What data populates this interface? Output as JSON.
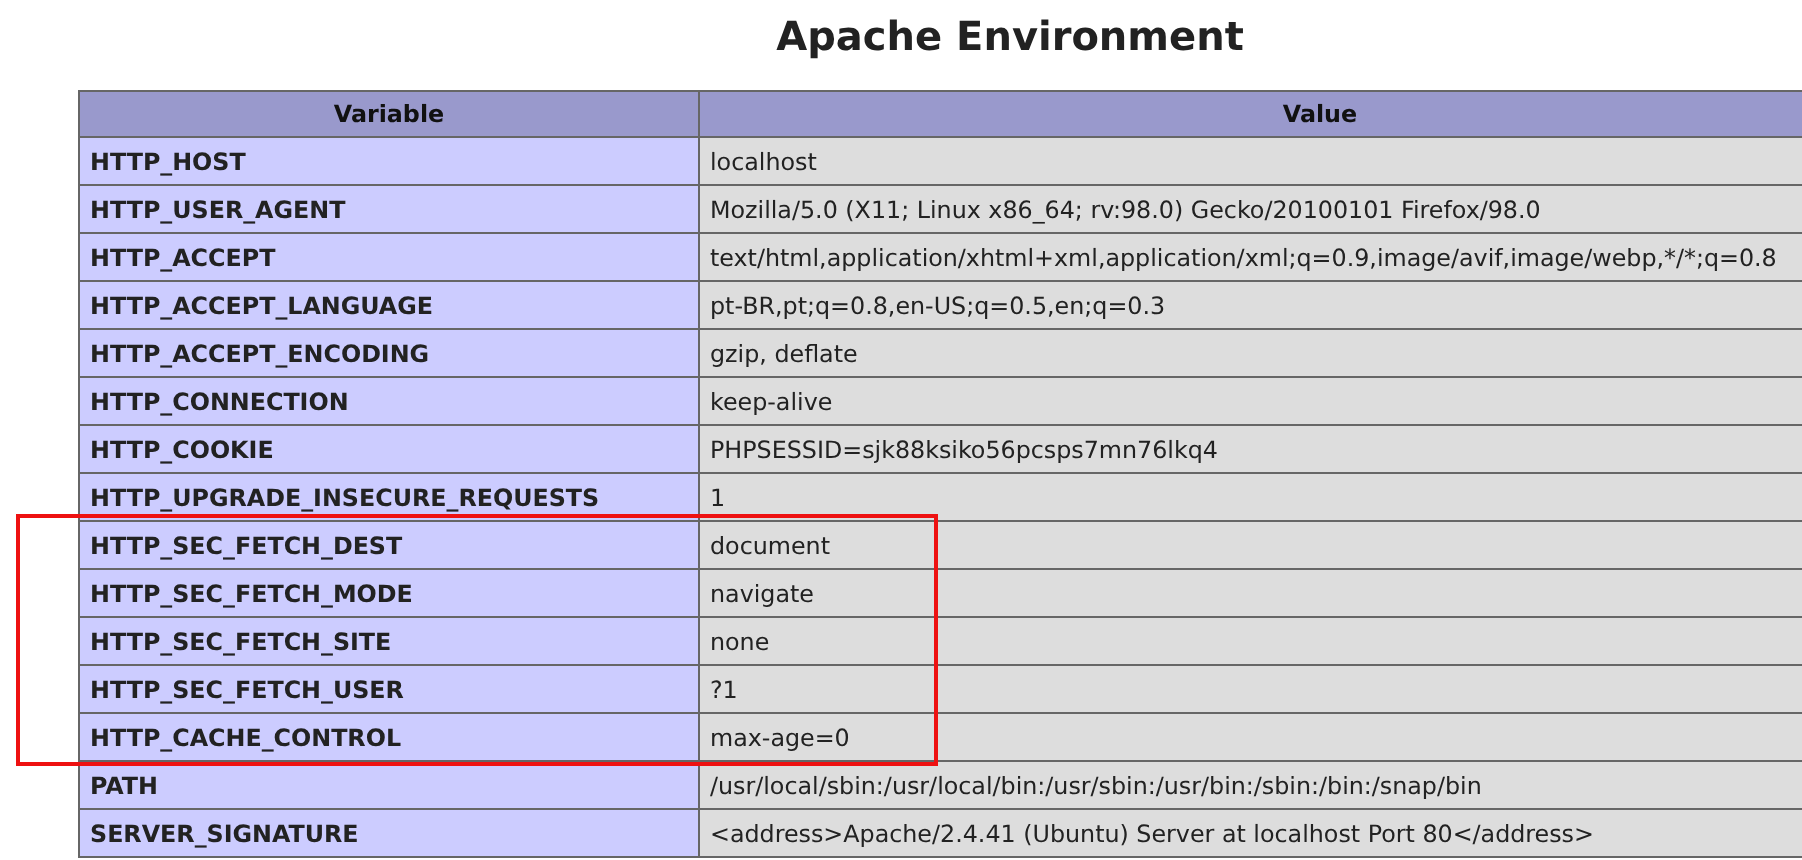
{
  "title": "Apache Environment",
  "table": {
    "columns": [
      "Variable",
      "Value"
    ],
    "rows": [
      {
        "variable": "HTTP_HOST",
        "value": "localhost",
        "highlighted": false
      },
      {
        "variable": "HTTP_USER_AGENT",
        "value": "Mozilla/5.0 (X11; Linux x86_64; rv:98.0) Gecko/20100101 Firefox/98.0",
        "highlighted": false
      },
      {
        "variable": "HTTP_ACCEPT",
        "value": "text/html,application/xhtml+xml,application/xml;q=0.9,image/avif,image/webp,*/*;q=0.8",
        "highlighted": false
      },
      {
        "variable": "HTTP_ACCEPT_LANGUAGE",
        "value": "pt-BR,pt;q=0.8,en-US;q=0.5,en;q=0.3",
        "highlighted": false
      },
      {
        "variable": "HTTP_ACCEPT_ENCODING",
        "value": "gzip, deflate",
        "highlighted": false
      },
      {
        "variable": "HTTP_CONNECTION",
        "value": "keep-alive",
        "highlighted": false
      },
      {
        "variable": "HTTP_COOKIE",
        "value": "PHPSESSID=sjk88ksiko56pcsps7mn76lkq4",
        "highlighted": false
      },
      {
        "variable": "HTTP_UPGRADE_INSECURE_REQUESTS",
        "value": "1",
        "highlighted": false
      },
      {
        "variable": "HTTP_SEC_FETCH_DEST",
        "value": "document",
        "highlighted": true
      },
      {
        "variable": "HTTP_SEC_FETCH_MODE",
        "value": "navigate",
        "highlighted": true
      },
      {
        "variable": "HTTP_SEC_FETCH_SITE",
        "value": "none",
        "highlighted": true
      },
      {
        "variable": "HTTP_SEC_FETCH_USER",
        "value": "?1",
        "highlighted": true
      },
      {
        "variable": "HTTP_CACHE_CONTROL",
        "value": "max-age=0",
        "highlighted": true
      },
      {
        "variable": "PATH",
        "value": "/usr/local/sbin:/usr/local/bin:/usr/sbin:/usr/bin:/sbin:/bin:/snap/bin",
        "highlighted": false
      },
      {
        "variable": "SERVER_SIGNATURE",
        "value": "<address>Apache/2.4.41 (Ubuntu) Server at localhost Port 80</address>",
        "highlighted": false
      }
    ]
  }
}
